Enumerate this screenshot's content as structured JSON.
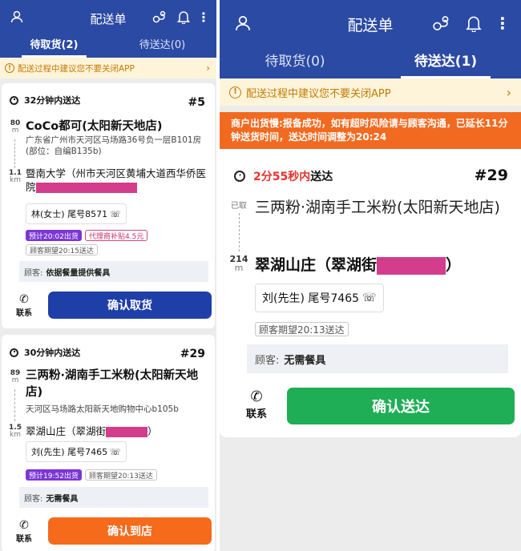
{
  "left": {
    "header": {
      "title": "配送单"
    },
    "tabs": [
      {
        "label": "待取货(2)",
        "active": true
      },
      {
        "label": "待送达(0)",
        "active": false
      }
    ],
    "notice": "配送过程中建议您不要关闭APP",
    "orders": [
      {
        "eta": "32分钟内送达",
        "order_no": "#5",
        "pickup_distance": {
          "value": "80",
          "unit": "m"
        },
        "store_name": "CoCo都可(太阳新天地店)",
        "store_address": "广东省广州市天河区马场路36号负一层B101房(部位：自编B135b)",
        "delivery_distance": {
          "value": "1.1",
          "unit": "km"
        },
        "delivery_address": "暨南大学（州市天河区黄埔大道西华侨医院",
        "customer": "林(女士) 尾号8571",
        "tags": [
          "预计20:02出货",
          "代理商补贴4.5元",
          "顾客期望20:15送达"
        ],
        "meal_label": "顾客:",
        "meal_value": "依据餐量提供餐具",
        "contact_label": "联系",
        "button_label": "确认取货"
      },
      {
        "eta": "30分钟内送达",
        "order_no": "#29",
        "pickup_distance": {
          "value": "89",
          "unit": "m"
        },
        "store_name": "三两粉·湖南手工米粉(太阳新天地店)",
        "store_address": "天河区马场路太阳新天地购物中心b105b",
        "delivery_distance": {
          "value": "1.5",
          "unit": "km"
        },
        "delivery_address": "翠湖山庄（翠湖街",
        "delivery_address_end": "）",
        "customer": "刘(先生) 尾号7465",
        "tags": [
          "预计19:52出货",
          "顾客期望20:13送达"
        ],
        "meal_label": "顾客:",
        "meal_value": "无需餐具",
        "contact_label": "联系",
        "button_label": "确认到店"
      }
    ]
  },
  "right": {
    "header": {
      "title": "配送单"
    },
    "tabs": [
      {
        "label": "待取货(0)",
        "active": false
      },
      {
        "label": "待送达(1)",
        "active": true
      }
    ],
    "notice": "配送过程中建议您不要关闭APP",
    "banner": "商户出货慢:报备成功，如有超时风险请与顾客沟通，已延长11分钟送货时间，送达时间调整为20:24",
    "order": {
      "eta_time": "2分55秒内",
      "eta_suffix": "送达",
      "order_no": "#29",
      "pickup_status": "已取",
      "store_name": "三两粉·湖南手工米粉(太阳新天地店)",
      "delivery_distance": {
        "value": "214",
        "unit": "m"
      },
      "delivery_address": "翠湖山庄（翠湖街",
      "delivery_address_end": "）",
      "customer": "刘(先生) 尾号7465",
      "tag": "顾客期望20:13送达",
      "meal_label": "顾客:",
      "meal_value": "无需餐具",
      "contact_label": "联系",
      "button_label": "确认送达"
    }
  },
  "colors": {
    "header_blue": "#2b4aa3",
    "confirm_blue": "#1f3fa8",
    "confirm_orange": "#f56a1b",
    "confirm_green": "#1fae55",
    "banner_orange": "#f26a20",
    "redaction": "#d43c8c"
  }
}
